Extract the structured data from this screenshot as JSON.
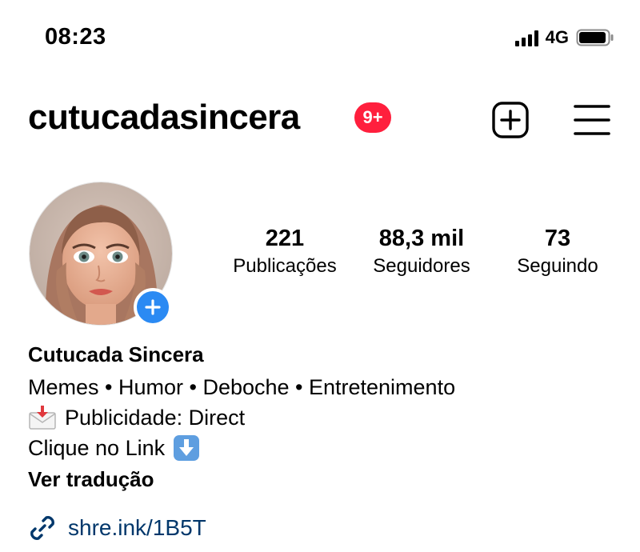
{
  "status_bar": {
    "time": "08:23",
    "network": "4G",
    "signal_bars": 4,
    "battery_level": 0.85
  },
  "header": {
    "username": "cutucadasincera",
    "notification_badge": "9+",
    "badge_color": "#ff1f3d",
    "create_icon": "plus-square-icon",
    "menu_icon": "hamburger-menu-icon"
  },
  "profile": {
    "avatar_icon": "profile-photo",
    "add_story_icon": "plus-icon",
    "add_story_color": "#2b8af3"
  },
  "stats": {
    "posts": {
      "value": "221",
      "label": "Publicações"
    },
    "followers": {
      "value": "88,3 mil",
      "label": "Seguidores"
    },
    "following": {
      "value": "73",
      "label": "Seguindo"
    }
  },
  "bio": {
    "display_name": "Cutucada Sincera",
    "categories": "Memes • Humor • Deboche • Entretenimento",
    "ads_line": "Publicidade: Direct",
    "ads_icon": "incoming-envelope-emoji",
    "link_hint": "Clique no Link",
    "link_hint_icon": "down-arrow-emoji",
    "see_translation": "Ver tradução",
    "link_icon": "link-icon",
    "link_text": "shre.ink/1B5T",
    "link_color": "#00376b"
  }
}
